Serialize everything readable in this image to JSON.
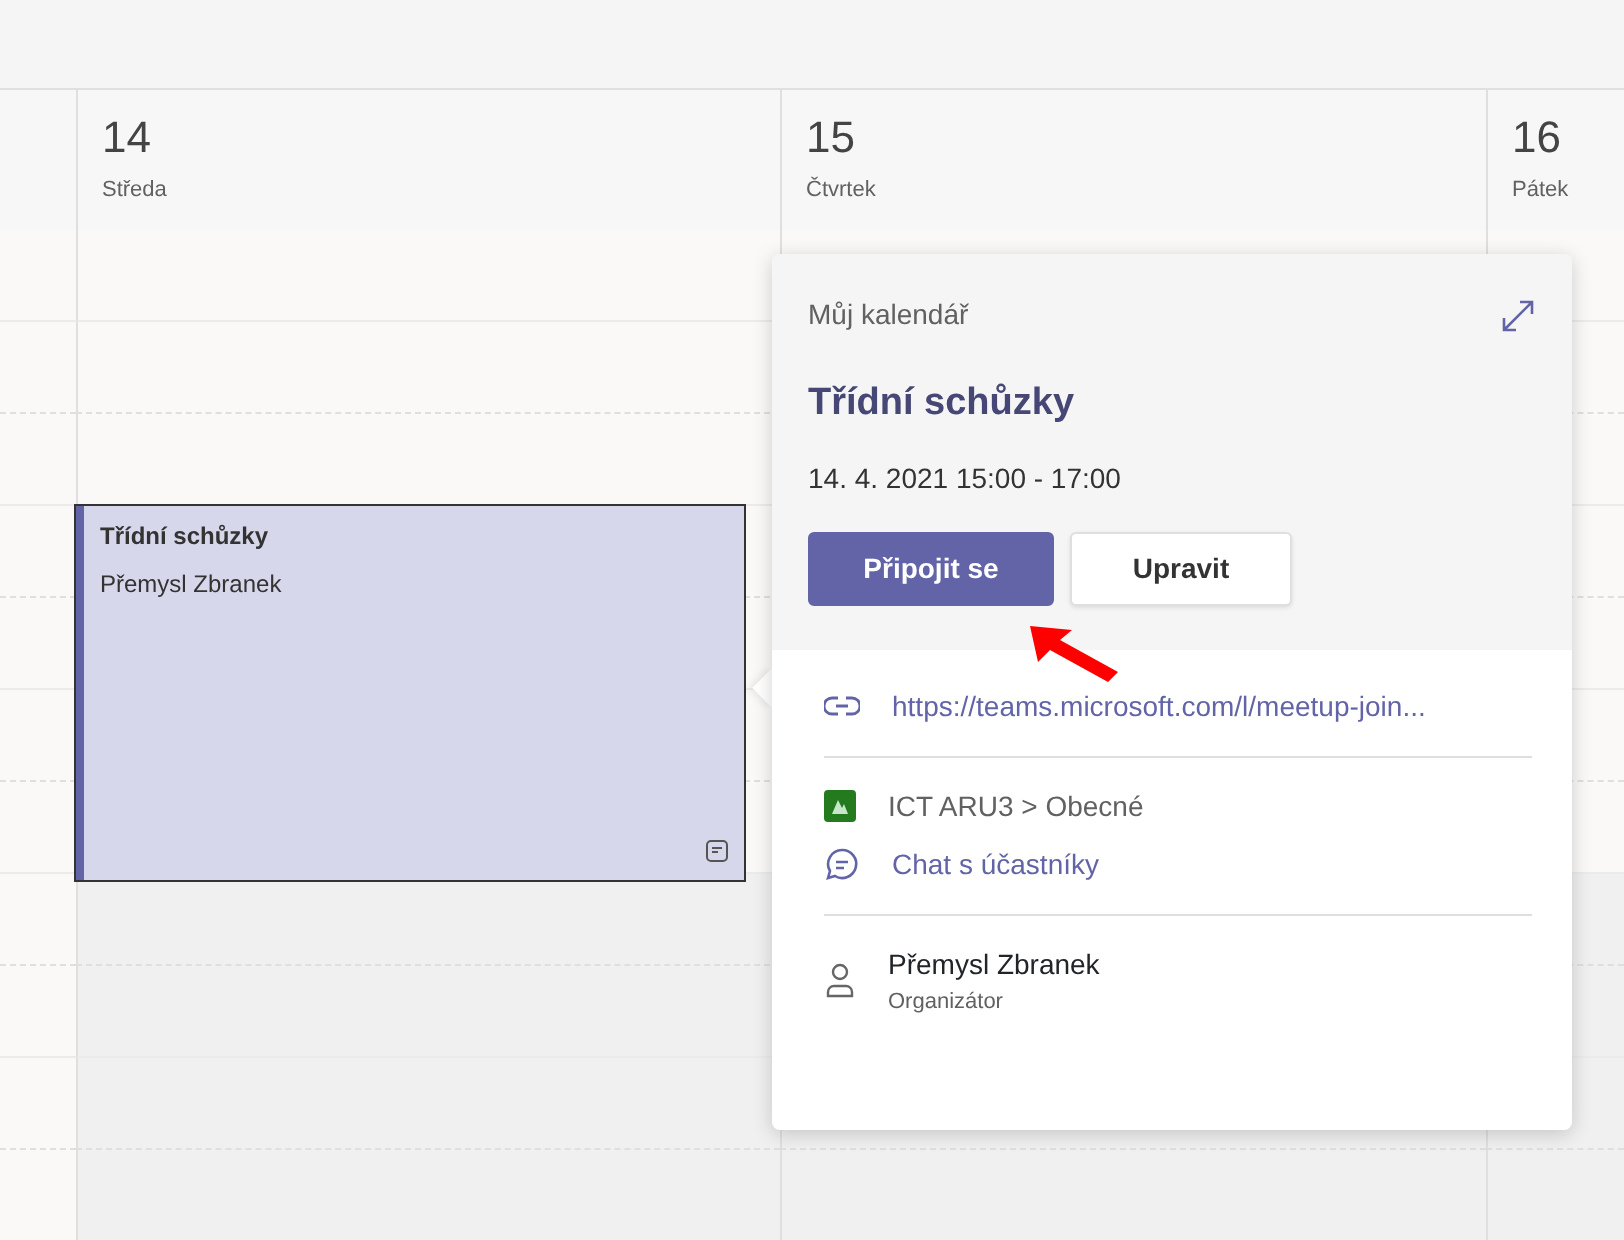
{
  "days": [
    {
      "number": "14",
      "name": "Středa"
    },
    {
      "number": "15",
      "name": "Čtvrtek"
    },
    {
      "number": "16",
      "name": "Pátek"
    }
  ],
  "events": [
    {
      "title": "Třídní schůzky",
      "organizer": "Přemysl Zbranek",
      "selected": true
    }
  ],
  "popover": {
    "calendar": "Můj kalendář",
    "title": "Třídní schůzky",
    "time": "14. 4. 2021 15:00 - 17:00",
    "buttons": [
      {
        "label": "Připojit se",
        "kind": "primary"
      },
      {
        "label": "Upravit",
        "kind": "secondary"
      }
    ],
    "link": "https://teams.microsoft.com/l/meetup-join...",
    "channel": "ICT ARU3 > Obecné",
    "chat": "Chat s účastníky",
    "organizer": {
      "name": "Přemysl Zbranek",
      "role": "Organizátor"
    }
  }
}
